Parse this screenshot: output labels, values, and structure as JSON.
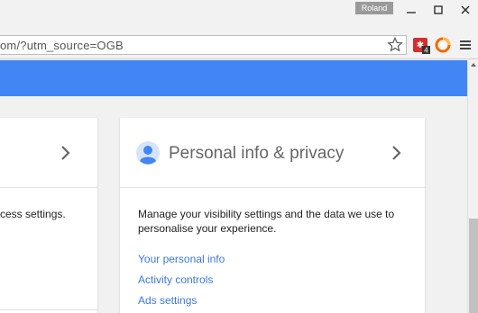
{
  "window": {
    "profile_name": "Roland"
  },
  "addressbar": {
    "url_text": "om/?utm_source=OGB"
  },
  "extensions": [
    {
      "icon": "red-extension-icon",
      "badge": "4"
    },
    {
      "icon": "orange-swirl-extension-icon"
    }
  ],
  "colors": {
    "accent": "#4285f4",
    "link": "#3d78d8",
    "extension_red": "#d32f2f",
    "extension_orange": "#ef6c00"
  },
  "left_card": {
    "text_fragment": "cess settings."
  },
  "right_card": {
    "title": "Personal info & privacy",
    "description": "Manage your visibility settings and the data we use to personalise your experience.",
    "links": [
      "Your personal info",
      "Activity controls",
      "Ads settings"
    ]
  }
}
